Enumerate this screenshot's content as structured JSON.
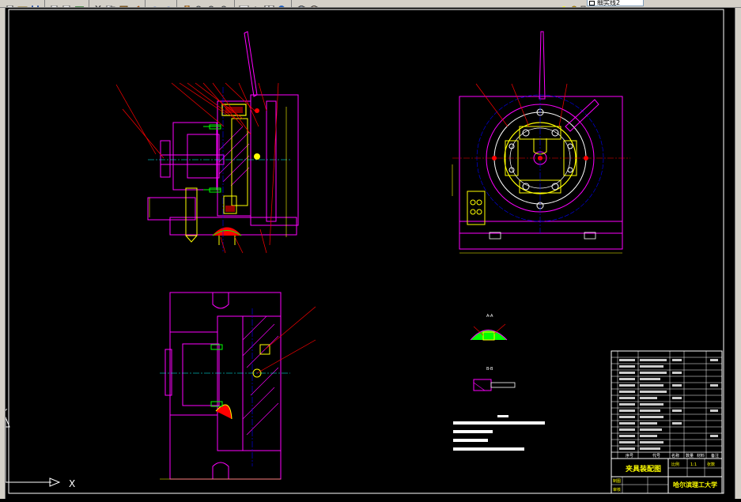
{
  "toolbar": {
    "icons": [
      "new-icon",
      "open-icon",
      "save-icon",
      "print-icon",
      "preview-icon",
      "publish-icon",
      "cut-icon",
      "copy-icon",
      "paste-icon",
      "matchprop-icon",
      "undo-icon",
      "redo-icon",
      "pan-icon",
      "zoom-realtime-icon",
      "zoom-window-icon",
      "zoom-previous-icon",
      "properties-icon",
      "text-style-icon",
      "table-icon",
      "help-icon",
      "layer-manager-icon",
      "layer-state-icon",
      "layer-on-icon",
      "layer-freeze-icon",
      "layer-lock-icon"
    ],
    "layer_combo_value": "细实线2"
  },
  "drawing": {
    "title_block": {
      "title": "夹具装配图",
      "school": "哈尔滨理工大学",
      "scale_label": "比例",
      "scale_value": "1:1",
      "sheet_label": "张数",
      "header_cells": [
        "序号",
        "代号",
        "名称",
        "数量",
        "材料",
        "备注"
      ],
      "drawn_by_label": "制图",
      "checked_by_label": "审核"
    },
    "section_labels": [
      "A-A",
      "B-B"
    ],
    "colors": {
      "background": "#000000",
      "outline": "#ff00ff",
      "cyan": "#00ffff",
      "yellow": "#ffff00",
      "red": "#ff0000",
      "blue": "#0000ff",
      "green": "#00ff00",
      "white": "#ffffff"
    }
  },
  "ucs": {
    "x_label": "X",
    "y_label": "Y"
  }
}
